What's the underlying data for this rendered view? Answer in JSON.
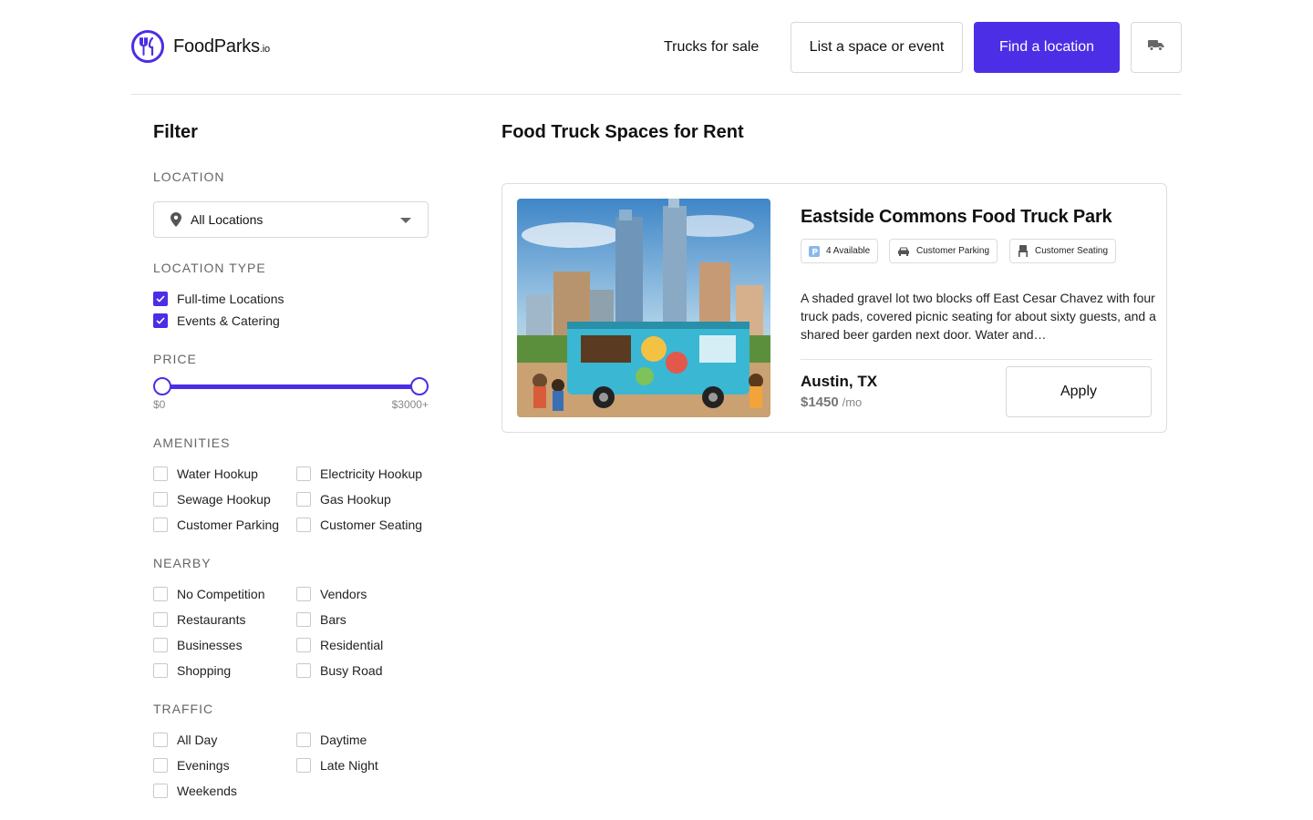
{
  "brand": {
    "name": "FoodParks",
    "suffix": ".io",
    "accent": "#4b2ee6"
  },
  "header": {
    "trucks_for_sale": "Trucks for sale",
    "list_space": "List a space or event",
    "find_location": "Find a location",
    "truck_icon": "truck-icon"
  },
  "filter": {
    "title": "Filter",
    "location": {
      "label": "LOCATION",
      "selected": "All Locations"
    },
    "location_type": {
      "label": "LOCATION TYPE",
      "options": [
        {
          "label": "Full-time Locations",
          "checked": true
        },
        {
          "label": "Events & Catering",
          "checked": true
        }
      ]
    },
    "price": {
      "label": "PRICE",
      "min_label": "$0",
      "max_label": "$3000+",
      "min": 0,
      "max": 3000
    },
    "amenities": {
      "label": "AMENITIES",
      "options": [
        "Water Hookup",
        "Electricity Hookup",
        "Sewage Hookup",
        "Gas Hookup",
        "Customer Parking",
        "Customer Seating"
      ]
    },
    "nearby": {
      "label": "NEARBY",
      "options": [
        "No Competition",
        "Vendors",
        "Restaurants",
        "Bars",
        "Businesses",
        "Residential",
        "Shopping",
        "Busy Road"
      ]
    },
    "traffic": {
      "label": "TRAFFIC",
      "options": [
        "All Day",
        "Daytime",
        "Evenings",
        "Late Night",
        "Weekends"
      ]
    }
  },
  "main": {
    "title": "Food Truck Spaces for Rent",
    "listing": {
      "title": "Eastside Commons Food Truck Park",
      "tags": [
        "4 Available",
        "Customer Parking",
        "Customer Seating"
      ],
      "description": "A shaded gravel lot two blocks off East Cesar Chavez with four truck pads, covered picnic seating for about sixty guests, and a shared beer garden next door. Water and…",
      "city": "Austin, TX",
      "price": "$1450",
      "price_unit": "/mo",
      "apply": "Apply"
    }
  }
}
